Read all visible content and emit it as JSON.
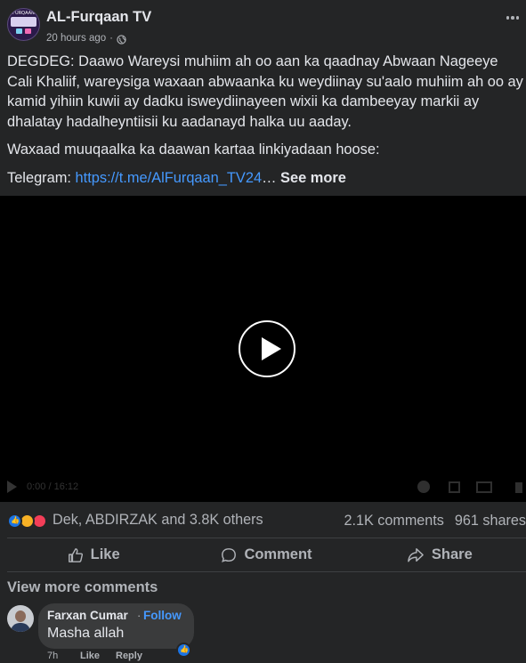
{
  "post": {
    "page_name": "AL-Furqaan TV",
    "avatar_logo_text": "FURQAAN",
    "timestamp": "20 hours ago",
    "separator": "·",
    "privacy_icon": "globe-icon",
    "more_icon": "more-horizontal-icon",
    "paragraphs": [
      "DEGDEG: Daawo Wareysi muhiim ah oo aan ka qaadnay Abwaan Nageeye Cali Khaliif, wareysiga waxaan abwaanka ku weydiinay su'aalo muhiim ah oo ay kamid yihiin kuwii ay dadku isweydiinayeen wixii ka dambeeyay markii ay dhalatay hadalheyntiisii ku aadanayd halka uu aaday.",
      "Waxaad muuqaalka ka daawan kartaa linkiyadaan hoose:"
    ],
    "telegram_label": "Telegram: ",
    "telegram_link": "https://t.me/AlFurqaan_TV24",
    "ellipsis": "…",
    "see_more": "See more"
  },
  "video": {
    "play_icon": "play-icon",
    "time_display": "0:00 / 16:12"
  },
  "engagement": {
    "reaction_icons": [
      "like-icon",
      "haha-icon",
      "love-icon"
    ],
    "reacted_by": "Dek, ABDIRZAK and 3.8K others",
    "comments": "2.1K comments",
    "shares": "961 shares"
  },
  "actions": {
    "like": "Like",
    "comment": "Comment",
    "share": "Share"
  },
  "comments_section": {
    "view_more": "View more comments",
    "items": [
      {
        "author": "Farxan Cumar",
        "separator": "·",
        "follow": "Follow",
        "text": "Masha allah",
        "time": "7h",
        "like": "Like",
        "reply": "Reply",
        "reaction_icon": "like-icon"
      }
    ]
  },
  "colors": {
    "background": "#242526",
    "text_primary": "#e4e6eb",
    "text_secondary": "#b0b3b8",
    "link": "#4599ff",
    "like_blue": "#1b74e4",
    "bubble": "#3a3b3c"
  }
}
